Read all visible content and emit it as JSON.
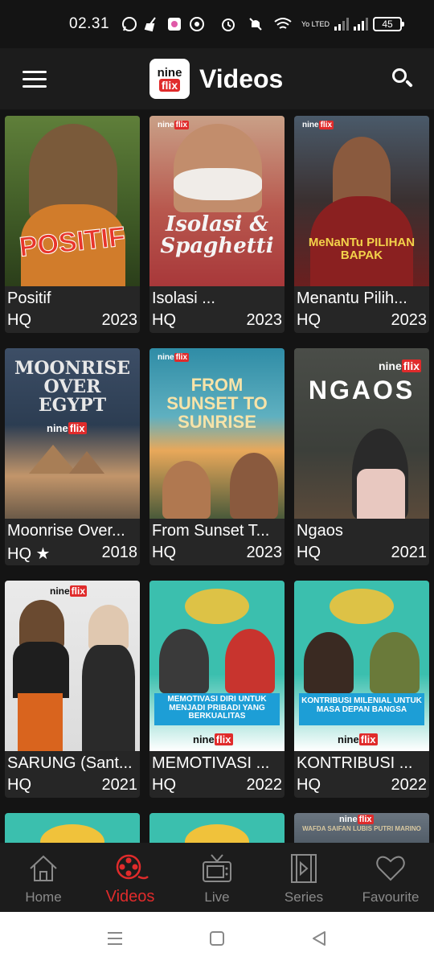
{
  "status_bar": {
    "time": "02.31",
    "network": "Yo LTED",
    "battery": "45"
  },
  "app_bar": {
    "logo_top": "nine",
    "logo_bottom": "flix",
    "title": "Videos"
  },
  "videos": [
    {
      "title": "Positif",
      "quality": "HQ",
      "year": "2023",
      "poster_text": "POSITIF",
      "colors": {
        "bg": "#4a6b2e",
        "accent": "#e8352b"
      }
    },
    {
      "title": "Isolasi ...",
      "quality": "HQ",
      "year": "2023",
      "poster_text": "Isolasi & Spaghetti",
      "colors": {
        "bg": "#b8403e",
        "accent": "#f2f2f2"
      }
    },
    {
      "title": "Menantu Pilih...",
      "quality": "HQ",
      "year": "2023",
      "poster_text": "MeNaNTu PILIHAN BAPAK",
      "colors": {
        "bg": "#6b1f1f",
        "accent": "#f3d24a"
      }
    },
    {
      "title": "Moonrise Over...",
      "quality": "HQ ★",
      "year": "2018",
      "poster_text": "MOONRISE OVER EGYPT",
      "colors": {
        "bg": "#2c3d52",
        "accent": "#e8e8e8"
      }
    },
    {
      "title": "From Sunset T...",
      "quality": "HQ",
      "year": "2023",
      "poster_text": "FROM SUNSET TO SUNRISE",
      "colors": {
        "bg": "#3a8fa8",
        "accent": "#f7e3a8"
      }
    },
    {
      "title": "Ngaos",
      "quality": "HQ",
      "year": "2021",
      "poster_text": "NGAOS",
      "colors": {
        "bg": "#3c3f3a",
        "accent": "#ffffff"
      }
    },
    {
      "title": "SARUNG (Sant...",
      "quality": "HQ",
      "year": "2021",
      "poster_text": "",
      "colors": {
        "bg": "#1a4a3a",
        "accent": "#d9641e"
      }
    },
    {
      "title": "MEMOTIVASI ...",
      "quality": "HQ",
      "year": "2022",
      "poster_text": "MEMOTIVASI DIRI UNTUK MENJADI PRIBADI YANG BERKUALITAS",
      "colors": {
        "bg": "#3bbfae",
        "accent": "#1d9ed6"
      }
    },
    {
      "title": "KONTRIBUSI ...",
      "quality": "HQ",
      "year": "2022",
      "poster_text": "KONTRIBUSI MILENIAL UNTUK MASA DEPAN BANGSA",
      "colors": {
        "bg": "#3bbfae",
        "accent": "#1d9ed6"
      }
    },
    {
      "title": "",
      "quality": "",
      "year": "",
      "poster_text": "",
      "colors": {
        "bg": "#3bbfae",
        "accent": "#f0c23b"
      }
    },
    {
      "title": "",
      "quality": "",
      "year": "",
      "poster_text": "",
      "colors": {
        "bg": "#3bbfae",
        "accent": "#f0c23b"
      }
    },
    {
      "title": "",
      "quality": "",
      "year": "",
      "poster_text": "WAFDA SAIFAN LUBIS  PUTRI MARINO",
      "colors": {
        "bg": "#4a5560",
        "accent": "#d8c8a0"
      }
    }
  ],
  "bottom_nav": [
    {
      "label": "Home",
      "icon": "home-icon",
      "active": false
    },
    {
      "label": "Videos",
      "icon": "film-reel-icon",
      "active": true
    },
    {
      "label": "Live",
      "icon": "tv-icon",
      "active": false
    },
    {
      "label": "Series",
      "icon": "film-strip-icon",
      "active": false
    },
    {
      "label": "Favourite",
      "icon": "heart-icon",
      "active": false
    }
  ],
  "colors": {
    "brand_red": "#e02b2b",
    "background": "#141414",
    "card": "#262626",
    "inactive": "#8a8a8a"
  }
}
